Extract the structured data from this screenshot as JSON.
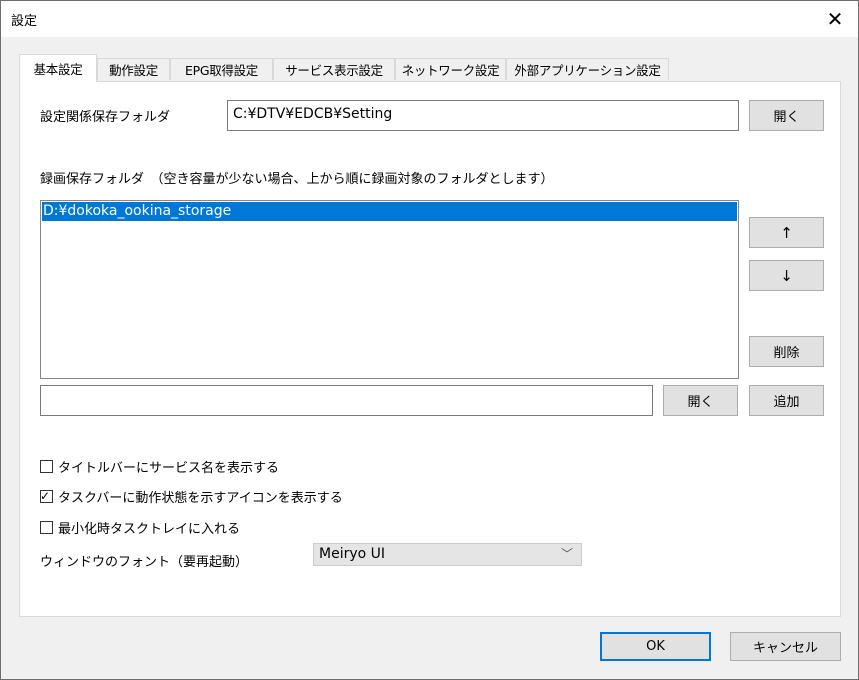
{
  "window": {
    "title": "設定",
    "close_glyph": "✕"
  },
  "tabs": [
    {
      "label": "基本設定",
      "active": true
    },
    {
      "label": "動作設定"
    },
    {
      "label": "EPG取得設定"
    },
    {
      "label": "サービス表示設定"
    },
    {
      "label": "ネットワーク設定"
    },
    {
      "label": "外部アプリケーション設定"
    }
  ],
  "settings_folder": {
    "label": "設定関係保存フォルダ",
    "value": "C:¥DTV¥EDCB¥Setting",
    "open_label": "開く"
  },
  "record_folders": {
    "label": "録画保存フォルダ　（空き容量が少ない場合、上から順に録画対象のフォルダとします）",
    "items": [
      "D:¥dokoka_ookina_storage"
    ],
    "up_label": "↑",
    "down_label": "↓",
    "delete_label": "削除",
    "new_value": "",
    "open_label": "開く",
    "add_label": "追加"
  },
  "options": [
    {
      "label": "タイトルバーにサービス名を表示する",
      "checked": false
    },
    {
      "label": "タスクバーに動作状態を示すアイコンを表示する",
      "checked": true
    },
    {
      "label": "最小化時タスクトレイに入れる",
      "checked": false
    }
  ],
  "font": {
    "label": "ウィンドウのフォント（要再起動）",
    "value": "Meiryo UI",
    "chevron": "﹀"
  },
  "footer": {
    "ok_label": "OK",
    "cancel_label": "キャンセル"
  },
  "colors": {
    "selection": "#0078d7",
    "dialog_bg": "#f0f0f0",
    "panel_bg": "#ffffff"
  }
}
